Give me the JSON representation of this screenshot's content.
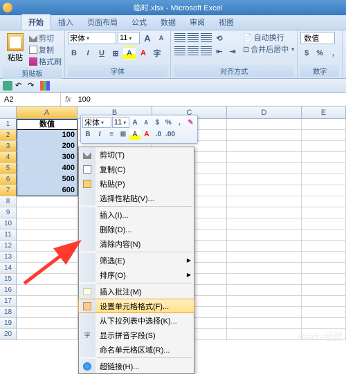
{
  "title": "临时.xlsx - Microsoft Excel",
  "tabs": [
    "开始",
    "插入",
    "页面布局",
    "公式",
    "数据",
    "审阅",
    "视图"
  ],
  "ribbon": {
    "clipboard": {
      "label": "剪贴板",
      "paste": "粘贴",
      "cut": "剪切",
      "copy": "复制",
      "format_painter": "格式刷"
    },
    "font": {
      "label": "字体",
      "name": "宋体",
      "size": "11",
      "bold": "B",
      "italic": "I",
      "underline": "U",
      "grow": "A",
      "shrink": "A"
    },
    "align": {
      "label": "对齐方式",
      "wrap": "自动换行",
      "merge": "合并后居中"
    },
    "number": {
      "label": "数字",
      "format": "数值"
    }
  },
  "name_box": "A2",
  "formula_value": "100",
  "columns": [
    "A",
    "B",
    "C",
    "D",
    "E"
  ],
  "sheet": {
    "header": "数值",
    "values": [
      "100",
      "200",
      "300",
      "400",
      "500",
      "600"
    ]
  },
  "mini_toolbar": {
    "font": "宋体",
    "size": "11"
  },
  "context_menu": {
    "cut": "剪切(T)",
    "copy": "复制(C)",
    "paste": "粘贴(P)",
    "paste_special": "选择性粘贴(V)...",
    "insert": "插入(I)...",
    "delete": "删除(D)...",
    "clear": "清除内容(N)",
    "filter": "筛选(E)",
    "sort": "排序(O)",
    "comment": "插入批注(M)",
    "format_cells": "设置单元格格式(F)...",
    "dropdown": "从下拉列表中选择(K)...",
    "phonetic": "显示拼音字段(S)",
    "name_range": "命名单元格区域(R)...",
    "hyperlink": "超链接(H)..."
  },
  "watermark": "Baidu经验"
}
